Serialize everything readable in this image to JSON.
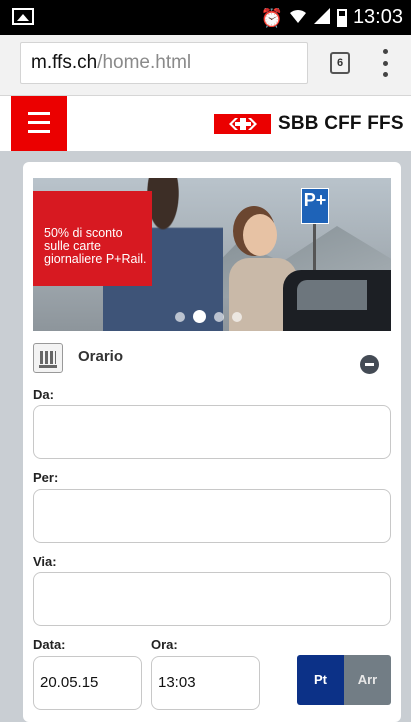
{
  "status_bar": {
    "time": "13:03",
    "icons": [
      "image-icon",
      "alarm-icon",
      "wifi-icon",
      "signal-icon",
      "battery-icon"
    ]
  },
  "browser": {
    "url_host": "m.ffs.ch",
    "url_path": "/home.html",
    "tab_count": "6",
    "icons": [
      "tabs-icon",
      "overflow-menu-icon"
    ]
  },
  "header": {
    "menu_icon": "hamburger-icon",
    "logo_text": "SBB CFF FFS",
    "brand_color": "#eb0000"
  },
  "banner": {
    "promo_text": "50% di sconto sulle carte giornaliere P+Rail.",
    "promo_color": "#d71921",
    "sign_text": "P+",
    "slides_total": 4,
    "active_slide": 2
  },
  "timetable": {
    "title": "Orario",
    "from_label": "Da:",
    "from_value": "",
    "to_label": "Per:",
    "to_value": "",
    "via_label": "Via:",
    "via_value": "",
    "date_label": "Data:",
    "date_value": "20.05.15",
    "time_label": "Ora:",
    "time_value": "13:03",
    "departure_label": "Pt",
    "arrival_label": "Arr",
    "selected_mode": "Pt",
    "selected_color": "#0c3187"
  }
}
